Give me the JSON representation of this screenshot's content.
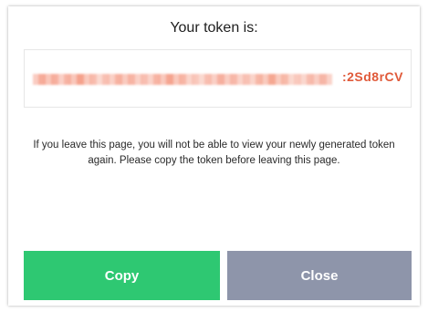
{
  "dialog": {
    "title": "Your token is:",
    "token_visible_suffix": ":2Sd8rCV",
    "message": "If you leave this page, you will not be able to view your newly generated token again. Please copy the token before leaving this page.",
    "copy_label": "Copy",
    "close_label": "Close"
  },
  "colors": {
    "copy_button": "#2ec872",
    "close_button": "#8e95aa",
    "token_text": "#e05a3a"
  }
}
